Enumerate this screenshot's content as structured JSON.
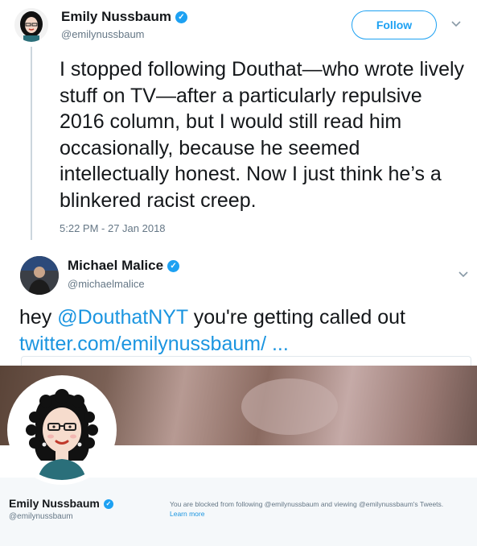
{
  "tweet1": {
    "name": "Emily Nussbaum",
    "handle": "@emilynussbaum",
    "follow_label": "Follow",
    "text": "I stopped following Douthat—who wrote lively stuff on  TV—after a particularly repulsive 2016 column, but I would still read him occasionally, because he seemed intellectually honest. Now I just think he’s a blinkered racist creep.",
    "timestamp": "5:22 PM - 27 Jan 2018"
  },
  "tweet2": {
    "name": "Michael Malice",
    "handle": "@michaelmalice",
    "text_pre": "hey ",
    "mention": "@DouthatNYT",
    "text_mid": " you're getting called out",
    "link": "twitter.com/emilynussbaum/ ..."
  },
  "profile": {
    "name": "Emily Nussbaum",
    "handle": "@emilynussbaum",
    "blocked_text": "You are blocked from following @emilynussbaum and viewing @emilynussbaum's Tweets.",
    "learn_more": "Learn more"
  },
  "icons": {
    "verified": "verified-badge-icon",
    "chevron": "chevron-down-icon"
  },
  "colors": {
    "accent": "#1da1f2",
    "link": "#1b95e0",
    "muted": "#657786"
  }
}
